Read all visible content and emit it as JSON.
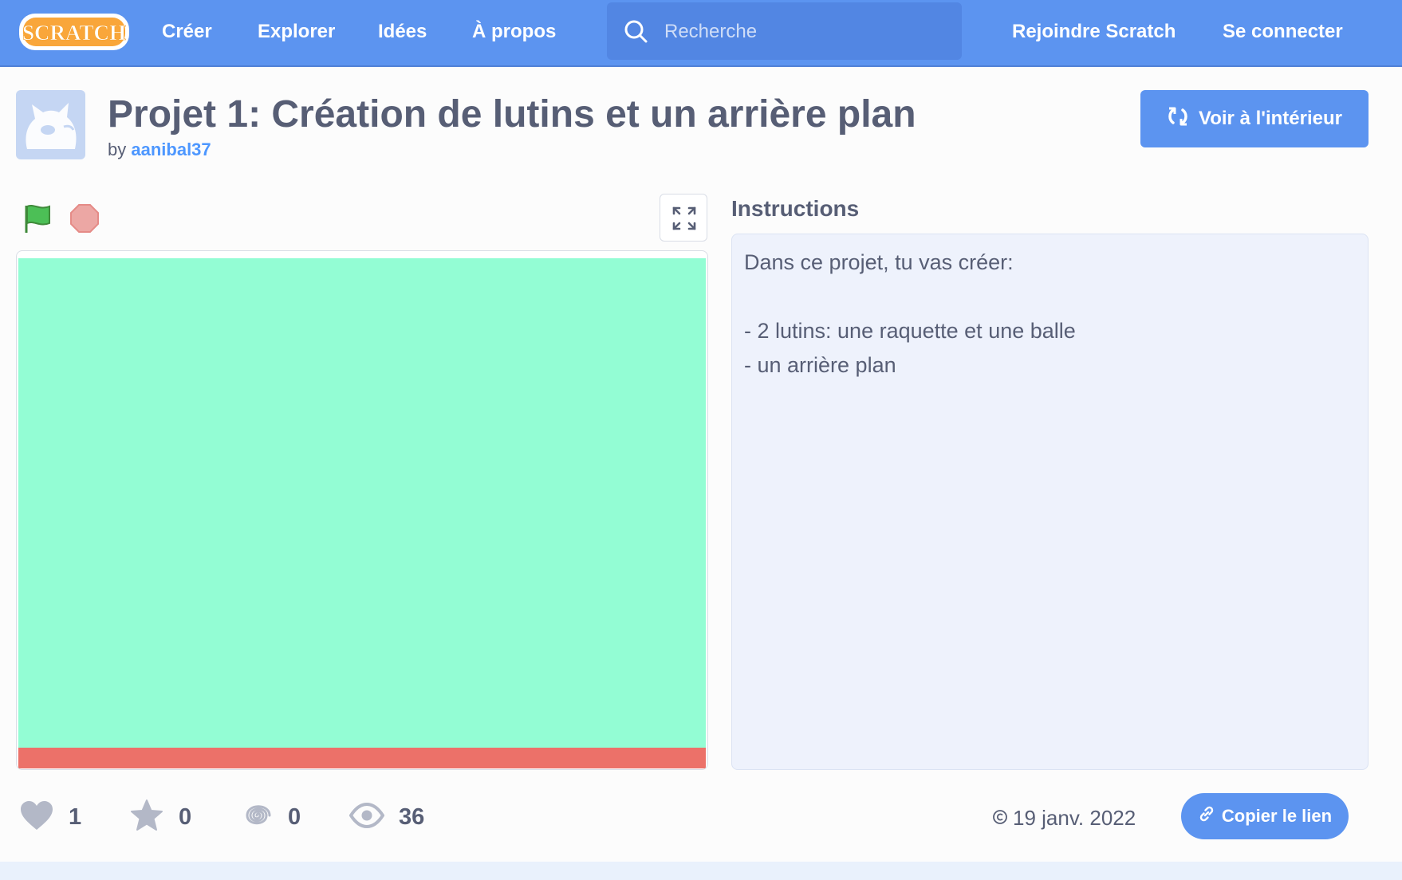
{
  "nav": {
    "logo_text": "SCRATCH",
    "links": [
      "Créer",
      "Explorer",
      "Idées",
      "À propos"
    ],
    "search_placeholder": "Recherche",
    "join_label": "Rejoindre Scratch",
    "signin_label": "Se connecter"
  },
  "project": {
    "title": "Projet 1: Création de lutins et un arrière plan",
    "by_label": "by",
    "author": "aanibal37",
    "see_inside_label": "Voir à l'intérieur"
  },
  "instructions": {
    "heading": "Instructions",
    "lines": [
      "Dans ce projet, tu vas créer:",
      "",
      "- 2 lutins: une raquette et une balle",
      "- un arrière plan"
    ]
  },
  "stats": {
    "loves": "1",
    "favorites": "0",
    "remixes": "0",
    "views": "36"
  },
  "footer": {
    "date": "19 janv. 2022",
    "copy_link_label": "Copier le lien"
  },
  "colors": {
    "nav": "#5c94f0",
    "stage_background": "#93fdd4",
    "stage_ground": "#ec7169",
    "text": "#575e75",
    "link": "#4d97ff"
  },
  "icons": [
    "search-icon",
    "remix-icon",
    "green-flag-icon",
    "stop-icon",
    "fullscreen-icon",
    "heart-icon",
    "star-icon",
    "remix-spiral-icon",
    "eye-icon",
    "copyright-icon",
    "link-icon"
  ]
}
